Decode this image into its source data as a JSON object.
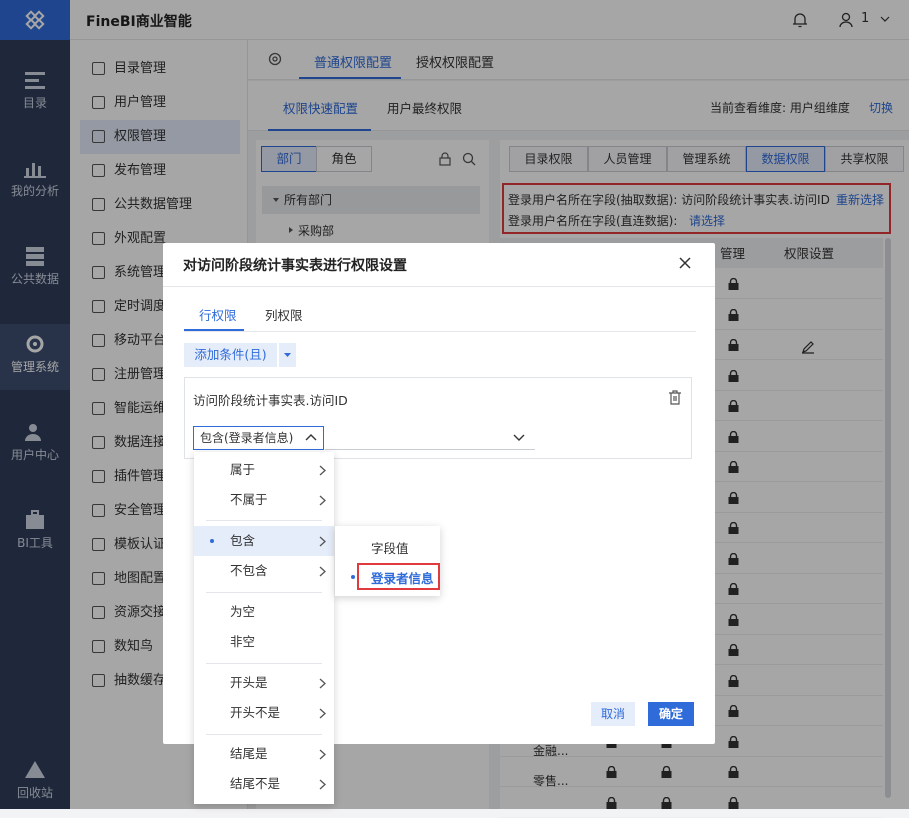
{
  "header": {
    "app_title": "FineBI商业智能",
    "user_count": "1"
  },
  "rail": [
    {
      "label": "目录",
      "icon": "catalog-icon"
    },
    {
      "label": "我的分析",
      "icon": "analysis-icon"
    },
    {
      "label": "公共数据",
      "icon": "public-data-icon"
    },
    {
      "label": "管理系统",
      "icon": "gear-icon",
      "active": true
    },
    {
      "label": "用户中心",
      "icon": "user-center-icon"
    },
    {
      "label": "BI工具",
      "icon": "toolbox-icon"
    },
    {
      "label": "回收站",
      "icon": "recycle-icon"
    }
  ],
  "sidebar": [
    "目录管理",
    "用户管理",
    "权限管理",
    "发布管理",
    "公共数据管理",
    "外观配置",
    "系统管理",
    "定时调度",
    "移动平台",
    "注册管理",
    "智能运维",
    "数据连接",
    "插件管理",
    "安全管理",
    "模板认证",
    "地图配置",
    "资源交接",
    "数知鸟",
    "抽数缓存"
  ],
  "tabs1": {
    "normal": "普通权限配置",
    "grant": "授权权限配置"
  },
  "tabs2": {
    "quick": "权限快速配置",
    "final": "用户最终权限",
    "dim_label": "当前查看维度:  用户组维度",
    "switch": "切换"
  },
  "dept": {
    "btn_dept": "部门",
    "btn_role": "角色",
    "root": "所有部门",
    "child": "采购部"
  },
  "rights_tabs": [
    "目录权限",
    "人员管理",
    "管理系统",
    "数据权限",
    "共享权限"
  ],
  "notice": {
    "line1": "登录用户名所在字段(抽取数据): 访问阶段统计事实表.访问ID",
    "reselect": "重新选择",
    "line2": "登录用户名所在字段(直连数据):",
    "choose": "请选择"
  },
  "table": {
    "col_manage": "管理",
    "col_perm": "权限设置",
    "row_a": "金融...",
    "row_b": "零售..."
  },
  "dialog": {
    "title": "对访问阶段统计事实表进行权限设置",
    "tab_row": "行权限",
    "tab_col": "列权限",
    "add_condition": "添加条件(且)",
    "field": "访问阶段统计事实表.访问ID",
    "operator": "包含(登录者信息)",
    "cancel": "取消",
    "ok": "确定"
  },
  "menu": [
    "属于",
    "不属于",
    "包含",
    "不包含",
    "为空",
    "非空",
    "开头是",
    "开头不是",
    "结尾是",
    "结尾不是"
  ],
  "submenu": {
    "field_value": "字段值",
    "login_info": "登录者信息"
  }
}
